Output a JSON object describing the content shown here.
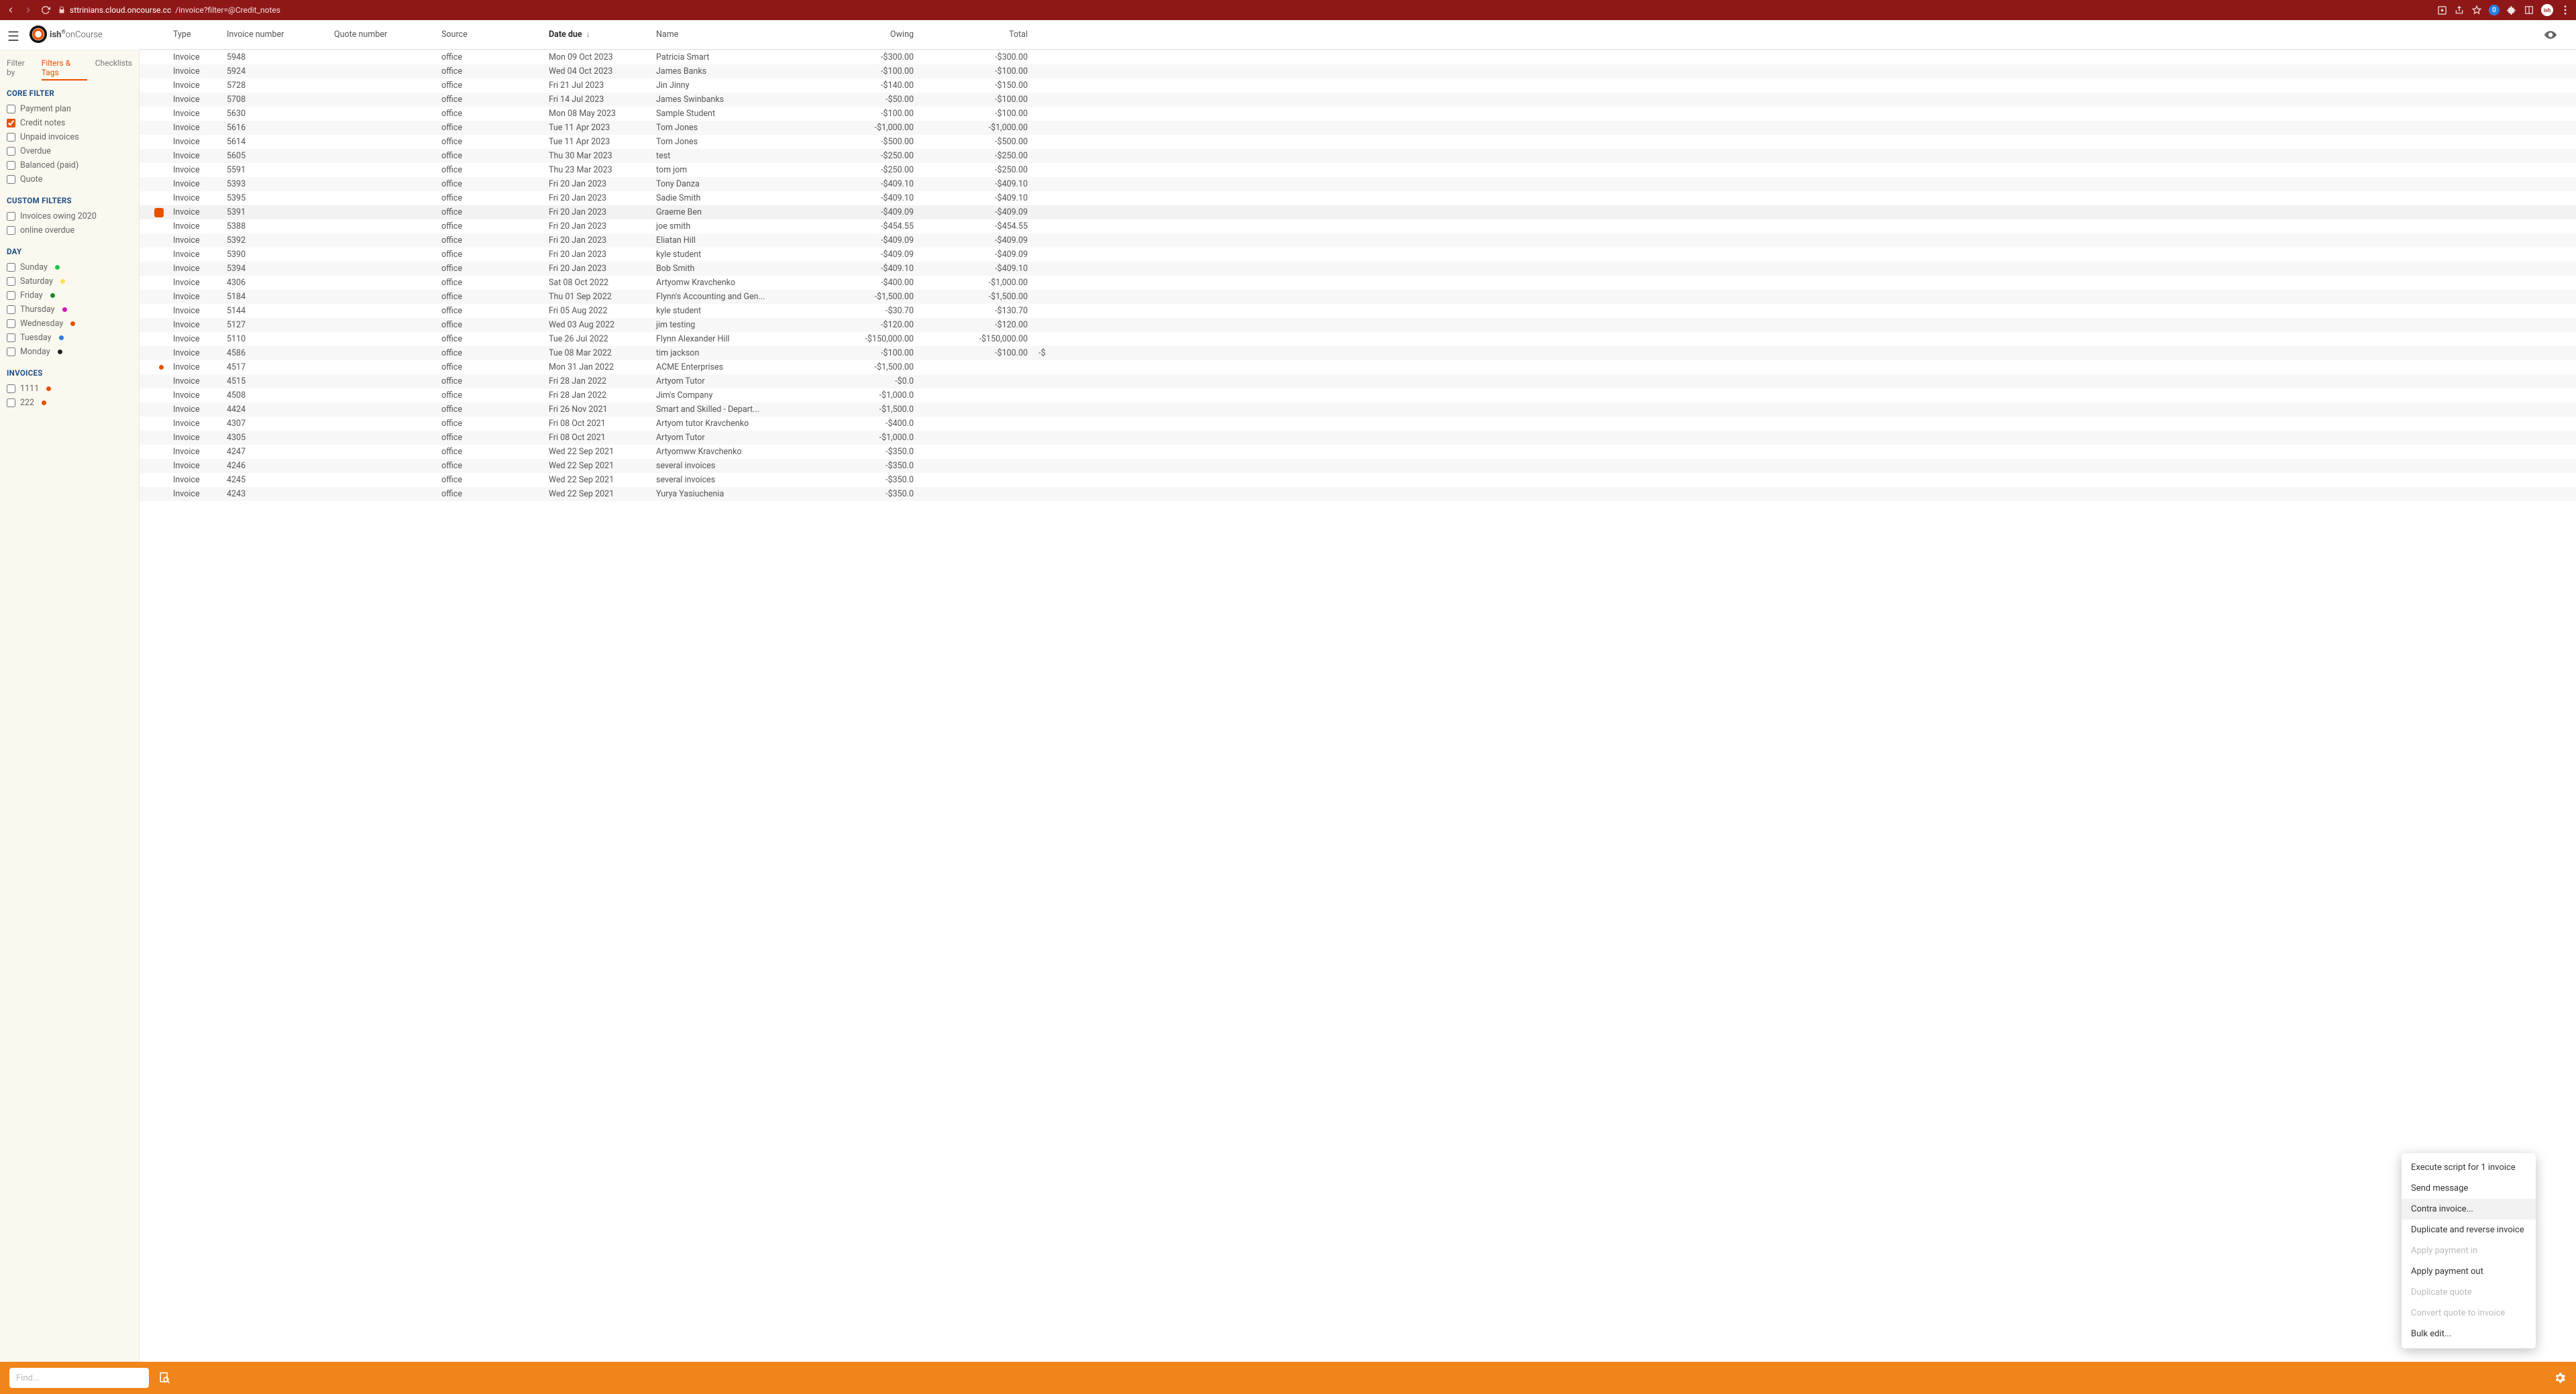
{
  "browser": {
    "url_prefix": "sttrinians.cloud.oncourse.cc",
    "url_path": "/invoice?filter=@Credit_notes",
    "avatar": "ish"
  },
  "logo": {
    "brand": "ish",
    "product": "onCourse"
  },
  "filter_tabs": {
    "label": "Filter by",
    "active": "Filters & Tags",
    "checklists": "Checklists"
  },
  "sections": {
    "core": {
      "title": "CORE FILTER",
      "items": [
        {
          "label": "Payment plan",
          "checked": false
        },
        {
          "label": "Credit notes",
          "checked": true
        },
        {
          "label": "Unpaid invoices",
          "checked": false
        },
        {
          "label": "Overdue",
          "checked": false
        },
        {
          "label": "Balanced (paid)",
          "checked": false
        },
        {
          "label": "Quote",
          "checked": false
        }
      ]
    },
    "custom": {
      "title": "CUSTOM FILTERS",
      "items": [
        {
          "label": "Invoices owing 2020",
          "checked": false
        },
        {
          "label": "online overdue",
          "checked": false
        }
      ]
    },
    "day": {
      "title": "DAY",
      "items": [
        {
          "label": "Sunday",
          "checked": false,
          "dot": "#1fc44b"
        },
        {
          "label": "Saturday",
          "checked": false,
          "dot": "#f9e24a"
        },
        {
          "label": "Friday",
          "checked": false,
          "dot": "#118a2a"
        },
        {
          "label": "Thursday",
          "checked": false,
          "dot": "#d11aa8"
        },
        {
          "label": "Wednesday",
          "checked": false,
          "dot": "#e65100"
        },
        {
          "label": "Tuesday",
          "checked": false,
          "dot": "#2c7be5"
        },
        {
          "label": "Monday",
          "checked": false,
          "dot": "#222"
        }
      ]
    },
    "invoices": {
      "title": "INVOICES",
      "items": [
        {
          "label": "1111",
          "checked": false,
          "dot": "#e65100"
        },
        {
          "label": "222",
          "checked": false,
          "dot": "#e65100"
        }
      ]
    }
  },
  "columns": {
    "type": "Type",
    "inv": "Invoice number",
    "quote": "Quote number",
    "src": "Source",
    "due": "Date due",
    "name": "Name",
    "owing": "Owing",
    "total": "Total"
  },
  "rows": [
    {
      "type": "Invoice",
      "inv": "5948",
      "src": "office",
      "due": "Mon 09 Oct 2023",
      "name": "Patricia Smart",
      "owing": "-$300.00",
      "total": "-$300.00"
    },
    {
      "type": "Invoice",
      "inv": "5924",
      "src": "office",
      "due": "Wed 04 Oct 2023",
      "name": "James Banks",
      "owing": "-$100.00",
      "total": "-$100.00"
    },
    {
      "type": "Invoice",
      "inv": "5728",
      "src": "office",
      "due": "Fri 21 Jul 2023",
      "name": "Jin Jinny",
      "owing": "-$140.00",
      "total": "-$150.00"
    },
    {
      "type": "Invoice",
      "inv": "5708",
      "src": "office",
      "due": "Fri 14 Jul 2023",
      "name": "James Swinbanks",
      "owing": "-$50.00",
      "total": "-$100.00"
    },
    {
      "type": "Invoice",
      "inv": "5630",
      "src": "office",
      "due": "Mon 08 May 2023",
      "name": "Sample Student",
      "owing": "-$100.00",
      "total": "-$100.00"
    },
    {
      "type": "Invoice",
      "inv": "5616",
      "src": "office",
      "due": "Tue 11 Apr 2023",
      "name": "Tom Jones",
      "owing": "-$1,000.00",
      "total": "-$1,000.00"
    },
    {
      "type": "Invoice",
      "inv": "5614",
      "src": "office",
      "due": "Tue 11 Apr 2023",
      "name": "Tom Jones",
      "owing": "-$500.00",
      "total": "-$500.00"
    },
    {
      "type": "Invoice",
      "inv": "5605",
      "src": "office",
      "due": "Thu 30 Mar 2023",
      "name": "test",
      "owing": "-$250.00",
      "total": "-$250.00"
    },
    {
      "type": "Invoice",
      "inv": "5591",
      "src": "office",
      "due": "Thu 23 Mar 2023",
      "name": "tom jom",
      "owing": "-$250.00",
      "total": "-$250.00"
    },
    {
      "type": "Invoice",
      "inv": "5393",
      "src": "office",
      "due": "Fri 20 Jan 2023",
      "name": "Tony Danza",
      "owing": "-$409.10",
      "total": "-$409.10"
    },
    {
      "type": "Invoice",
      "inv": "5395",
      "src": "office",
      "due": "Fri 20 Jan 2023",
      "name": "Sadie Smith",
      "owing": "-$409.10",
      "total": "-$409.10"
    },
    {
      "type": "Invoice",
      "inv": "5391",
      "src": "office",
      "due": "Fri 20 Jan 2023",
      "name": "Graeme Ben",
      "owing": "-$409.09",
      "total": "-$409.09",
      "selected": true
    },
    {
      "type": "Invoice",
      "inv": "5388",
      "src": "office",
      "due": "Fri 20 Jan 2023",
      "name": "joe smith",
      "owing": "-$454.55",
      "total": "-$454.55"
    },
    {
      "type": "Invoice",
      "inv": "5392",
      "src": "office",
      "due": "Fri 20 Jan 2023",
      "name": "Eliatan Hill",
      "owing": "-$409.09",
      "total": "-$409.09"
    },
    {
      "type": "Invoice",
      "inv": "5390",
      "src": "office",
      "due": "Fri 20 Jan 2023",
      "name": "kyle student",
      "owing": "-$409.09",
      "total": "-$409.09"
    },
    {
      "type": "Invoice",
      "inv": "5394",
      "src": "office",
      "due": "Fri 20 Jan 2023",
      "name": "Bob Smith",
      "owing": "-$409.10",
      "total": "-$409.10"
    },
    {
      "type": "Invoice",
      "inv": "4306",
      "src": "office",
      "due": "Sat 08 Oct 2022",
      "name": "Artyomw Kravchenko",
      "owing": "-$400.00",
      "total": "-$1,000.00"
    },
    {
      "type": "Invoice",
      "inv": "5184",
      "src": "office",
      "due": "Thu 01 Sep 2022",
      "name": "Flynn's Accounting and Gen...",
      "owing": "-$1,500.00",
      "total": "-$1,500.00"
    },
    {
      "type": "Invoice",
      "inv": "5144",
      "src": "office",
      "due": "Fri 05 Aug 2022",
      "name": "kyle student",
      "owing": "-$30.70",
      "total": "-$130.70"
    },
    {
      "type": "Invoice",
      "inv": "5127",
      "src": "office",
      "due": "Wed 03 Aug 2022",
      "name": "jim testing",
      "owing": "-$120.00",
      "total": "-$120.00"
    },
    {
      "type": "Invoice",
      "inv": "5110",
      "src": "office",
      "due": "Tue 26 Jul 2022",
      "name": "Flynn Alexander Hill",
      "owing": "-$150,000.00",
      "total": "-$150,000.00"
    },
    {
      "type": "Invoice",
      "inv": "4586",
      "src": "office",
      "due": "Tue 08 Mar 2022",
      "name": "tim jackson",
      "owing": "-$100.00",
      "total": "-$100.00",
      "extra": "-$"
    },
    {
      "type": "Invoice",
      "inv": "4517",
      "src": "office",
      "due": "Mon 31 Jan 2022",
      "name": "ACME Enterprises",
      "owing": "-$1,500.00",
      "total": "",
      "tag": "#e65100"
    },
    {
      "type": "Invoice",
      "inv": "4515",
      "src": "office",
      "due": "Fri 28 Jan 2022",
      "name": "Artyom Tutor",
      "owing": "-$0.0",
      "total": ""
    },
    {
      "type": "Invoice",
      "inv": "4508",
      "src": "office",
      "due": "Fri 28 Jan 2022",
      "name": "Jim's Company",
      "owing": "-$1,000.0",
      "total": ""
    },
    {
      "type": "Invoice",
      "inv": "4424",
      "src": "office",
      "due": "Fri 26 Nov 2021",
      "name": "Smart and Skilled - Depart...",
      "owing": "-$1,500.0",
      "total": ""
    },
    {
      "type": "Invoice",
      "inv": "4307",
      "src": "office",
      "due": "Fri 08 Oct 2021",
      "name": "Artyom tutor Kravchenko",
      "owing": "-$400.0",
      "total": ""
    },
    {
      "type": "Invoice",
      "inv": "4305",
      "src": "office",
      "due": "Fri 08 Oct 2021",
      "name": "Artyom Tutor",
      "owing": "-$1,000.0",
      "total": ""
    },
    {
      "type": "Invoice",
      "inv": "4247",
      "src": "office",
      "due": "Wed 22 Sep 2021",
      "name": "Artyomww Kravchenko",
      "owing": "-$350.0",
      "total": ""
    },
    {
      "type": "Invoice",
      "inv": "4246",
      "src": "office",
      "due": "Wed 22 Sep 2021",
      "name": "several invoices",
      "owing": "-$350.0",
      "total": ""
    },
    {
      "type": "Invoice",
      "inv": "4245",
      "src": "office",
      "due": "Wed 22 Sep 2021",
      "name": "several invoices",
      "owing": "-$350.0",
      "total": ""
    },
    {
      "type": "Invoice",
      "inv": "4243",
      "src": "office",
      "due": "Wed 22 Sep 2021",
      "name": "Yurya Yasiuchenia",
      "owing": "-$350.0",
      "total": ""
    }
  ],
  "context_menu": [
    {
      "label": "Execute script for 1 invoice",
      "enabled": true
    },
    {
      "label": "Send message",
      "enabled": true
    },
    {
      "label": "Contra invoice...",
      "enabled": true,
      "hover": true
    },
    {
      "label": "Duplicate and reverse invoice",
      "enabled": true
    },
    {
      "label": "Apply payment in",
      "enabled": false
    },
    {
      "label": "Apply payment out",
      "enabled": true
    },
    {
      "label": "Duplicate quote",
      "enabled": false
    },
    {
      "label": "Convert quote to invoice",
      "enabled": false
    },
    {
      "label": "Bulk edit...",
      "enabled": true
    }
  ],
  "search_placeholder": "Find..."
}
